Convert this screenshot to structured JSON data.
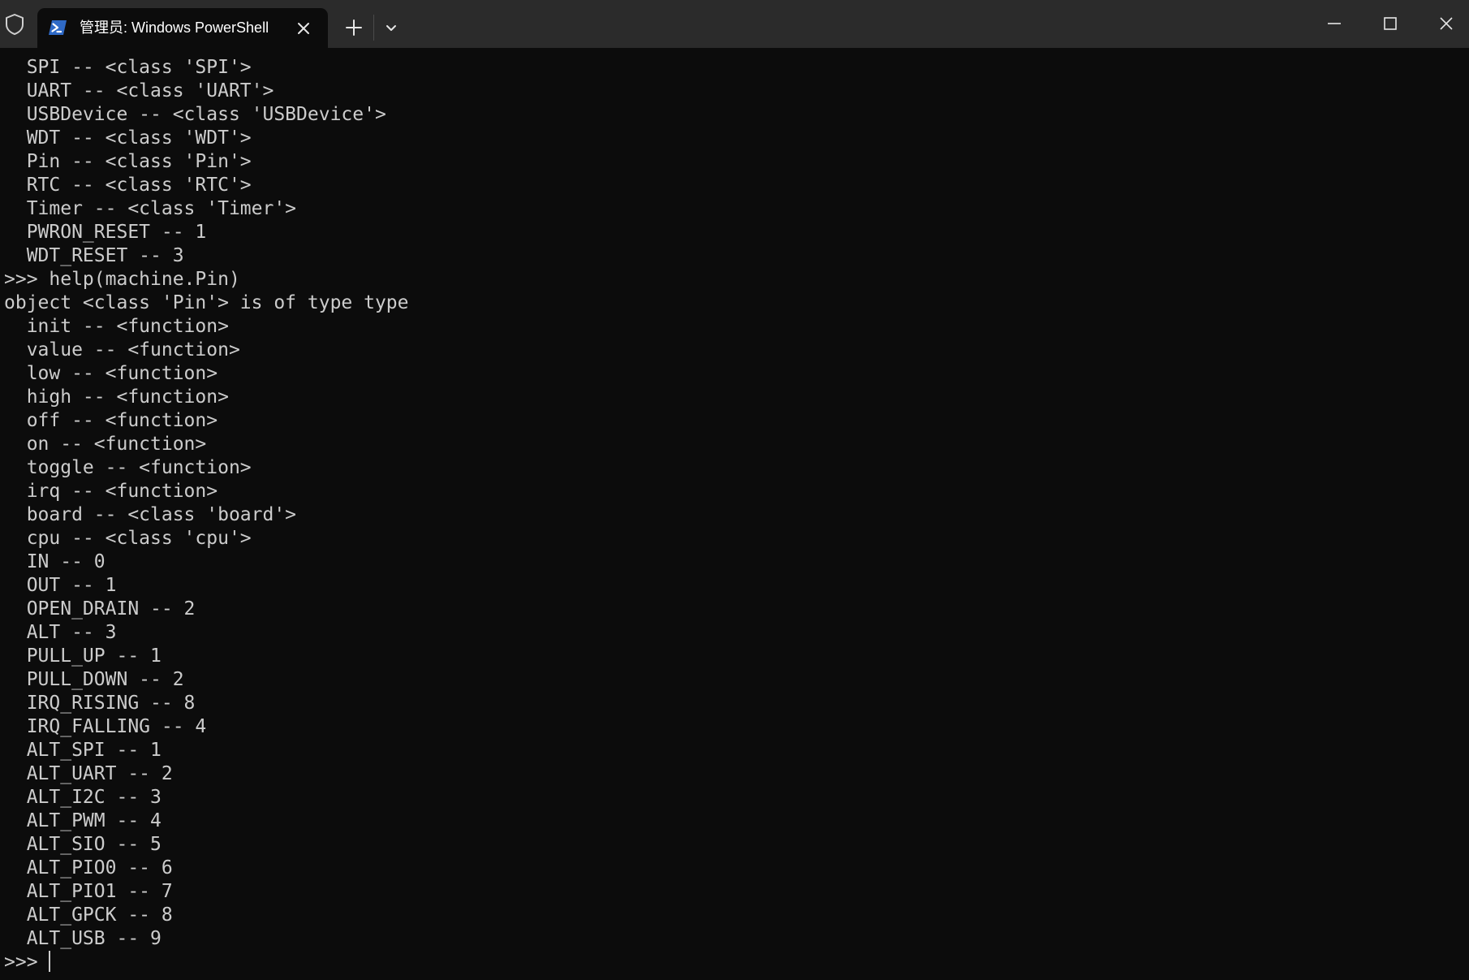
{
  "window": {
    "tab_title": "管理员: Windows PowerShell",
    "icons": {
      "shield": "shield-icon",
      "tab": "powershell-icon",
      "close_tab": "close-icon",
      "new_tab": "plus-icon",
      "dropdown": "chevron-down-icon",
      "minimize": "minimize-icon",
      "maximize": "maximize-icon",
      "close": "close-icon"
    }
  },
  "terminal": {
    "lines": [
      "  SPI -- <class 'SPI'>",
      "  UART -- <class 'UART'>",
      "  USBDevice -- <class 'USBDevice'>",
      "  WDT -- <class 'WDT'>",
      "  Pin -- <class 'Pin'>",
      "  RTC -- <class 'RTC'>",
      "  Timer -- <class 'Timer'>",
      "  PWRON_RESET -- 1",
      "  WDT_RESET -- 3",
      ">>> help(machine.Pin)",
      "object <class 'Pin'> is of type type",
      "  init -- <function>",
      "  value -- <function>",
      "  low -- <function>",
      "  high -- <function>",
      "  off -- <function>",
      "  on -- <function>",
      "  toggle -- <function>",
      "  irq -- <function>",
      "  board -- <class 'board'>",
      "  cpu -- <class 'cpu'>",
      "  IN -- 0",
      "  OUT -- 1",
      "  OPEN_DRAIN -- 2",
      "  ALT -- 3",
      "  PULL_UP -- 1",
      "  PULL_DOWN -- 2",
      "  IRQ_RISING -- 8",
      "  IRQ_FALLING -- 4",
      "  ALT_SPI -- 1",
      "  ALT_UART -- 2",
      "  ALT_I2C -- 3",
      "  ALT_PWM -- 4",
      "  ALT_SIO -- 5",
      "  ALT_PIO0 -- 6",
      "  ALT_PIO1 -- 7",
      "  ALT_GPCK -- 8",
      "  ALT_USB -- 9"
    ],
    "prompt": ">>> "
  },
  "colors": {
    "background": "#0c0c0c",
    "titlebar": "#2b2b2b",
    "text": "#cccccc",
    "powershell_blue": "#2f6ac7"
  }
}
